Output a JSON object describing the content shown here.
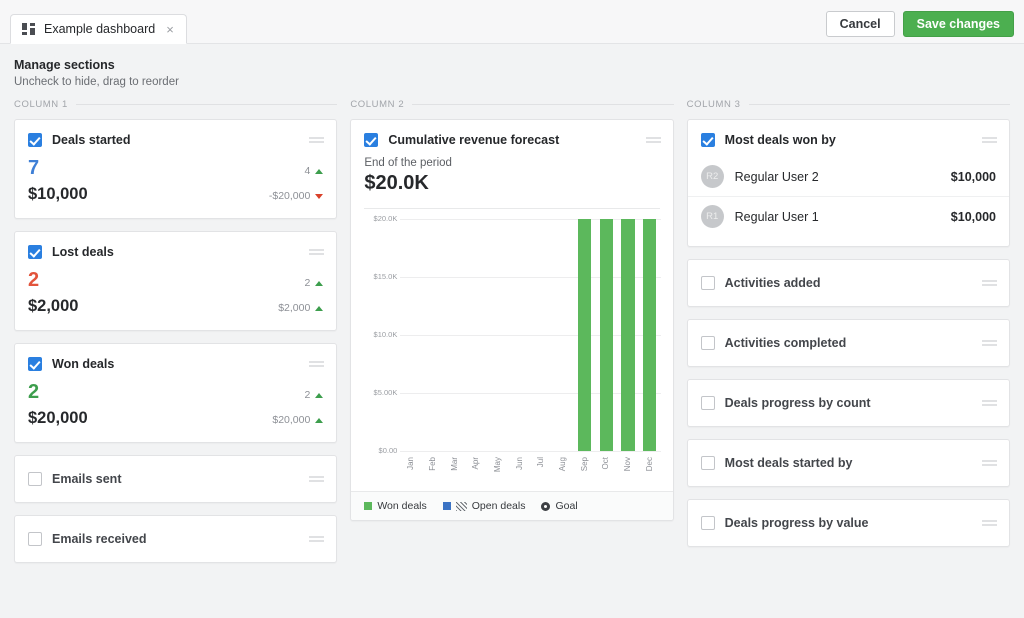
{
  "topbar": {
    "tab_icon": "dashboard-grid-icon",
    "tab_title": "Example dashboard",
    "tab_close": "×",
    "cancel_label": "Cancel",
    "save_label": "Save changes",
    "save_color": "#4caf50"
  },
  "header": {
    "title": "Manage sections",
    "subtitle": "Uncheck to hide, drag to reorder"
  },
  "columns": [
    {
      "label": "COLUMN 1",
      "cards": [
        {
          "title": "Deals started",
          "checked": true,
          "type": "metric",
          "count": "7",
          "count_color": "blue",
          "amount": "$10,000",
          "count_delta": "4",
          "count_dir": "up",
          "amount_delta": "-$20,000",
          "amount_dir": "down"
        },
        {
          "title": "Lost deals",
          "checked": true,
          "type": "metric",
          "count": "2",
          "count_color": "red",
          "amount": "$2,000",
          "count_delta": "2",
          "count_dir": "up",
          "amount_delta": "$2,000",
          "amount_dir": "up"
        },
        {
          "title": "Won deals",
          "checked": true,
          "type": "metric",
          "count": "2",
          "count_color": "green",
          "amount": "$20,000",
          "count_delta": "2",
          "count_dir": "up",
          "amount_delta": "$20,000",
          "amount_dir": "up"
        },
        {
          "title": "Emails sent",
          "checked": false,
          "type": "collapsed"
        },
        {
          "title": "Emails received",
          "checked": false,
          "type": "collapsed"
        }
      ]
    },
    {
      "label": "COLUMN 2",
      "cards": [
        {
          "title": "Cumulative revenue forecast",
          "checked": true,
          "type": "chart",
          "sublabel": "End of the period",
          "bigvalue": "$20.0K"
        }
      ]
    },
    {
      "label": "COLUMN 3",
      "cards": [
        {
          "title": "Most deals won by",
          "checked": true,
          "type": "users",
          "users": [
            {
              "initials": "R2",
              "name": "Regular User 2",
              "value": "$10,000"
            },
            {
              "initials": "R1",
              "name": "Regular User 1",
              "value": "$10,000"
            }
          ]
        },
        {
          "title": "Activities added",
          "checked": false,
          "type": "collapsed"
        },
        {
          "title": "Activities completed",
          "checked": false,
          "type": "collapsed"
        },
        {
          "title": "Deals progress by count",
          "checked": false,
          "type": "collapsed"
        },
        {
          "title": "Most deals started by",
          "checked": false,
          "type": "collapsed"
        },
        {
          "title": "Deals progress by value",
          "checked": false,
          "type": "collapsed"
        }
      ]
    }
  ],
  "chart_data": {
    "type": "bar",
    "title": "Cumulative revenue forecast",
    "subtitle": "End of the period",
    "annotation": "$20.0K",
    "categories": [
      "Jan",
      "Feb",
      "Mar",
      "Apr",
      "May",
      "Jun",
      "Jul",
      "Aug",
      "Sep",
      "Oct",
      "Nov",
      "Dec"
    ],
    "series": [
      {
        "name": "Won deals",
        "color": "#5cb85c",
        "values": [
          0,
          0,
          0,
          0,
          0,
          0,
          0,
          0,
          20000,
          20000,
          20000,
          20000
        ]
      },
      {
        "name": "Open deals",
        "color": "#3b73c4",
        "values": [
          0,
          0,
          0,
          0,
          0,
          0,
          0,
          0,
          0,
          0,
          0,
          0
        ]
      }
    ],
    "legend": [
      {
        "name": "Won deals",
        "color": "#5cb85c",
        "glyph": "square"
      },
      {
        "name": "Open deals",
        "color": "#3b73c4",
        "glyph": "square-hatched"
      },
      {
        "name": "Goal",
        "color": "#3d4044",
        "glyph": "target-dot"
      }
    ],
    "legend_position": "bottom",
    "ylabel": "",
    "xlabel": "",
    "ylim": [
      0,
      20000
    ],
    "yticks": [
      0,
      5000,
      10000,
      15000,
      20000
    ],
    "ytick_labels": [
      "$0.00",
      "$5.00K",
      "$10.0K",
      "$15.0K",
      "$20.0K"
    ],
    "grid": true
  }
}
